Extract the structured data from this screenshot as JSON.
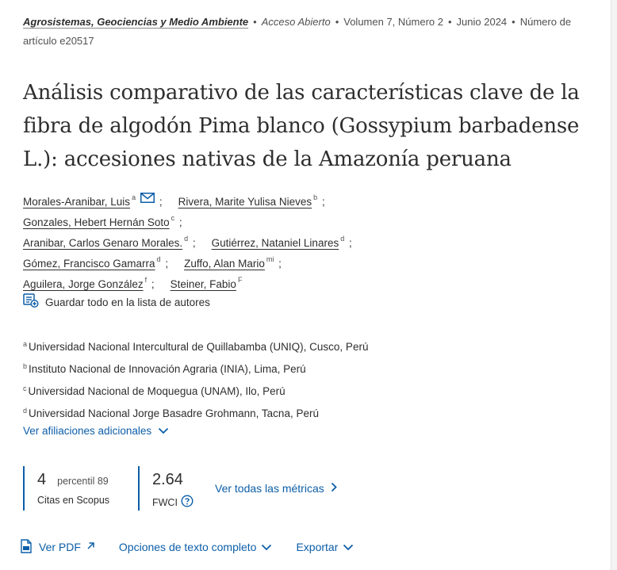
{
  "meta": {
    "journal": "Agrosistemas, Geociencias y Medio Ambiente",
    "access": "Acceso Abierto",
    "volume": "Volumen 7, Número 2",
    "date": "Junio 2024",
    "article_number": "Número de artículo e20517"
  },
  "title": "Análisis comparativo de las características clave de la fibra de algodón Pima blanco (Gossypium barbadense L.): accesiones nativas de la Amazonía peruana",
  "authors": [
    {
      "name": "Morales-Aranibar, Luis",
      "sup": "a"
    },
    {
      "name": "Rivera, Marite Yulisa Nieves",
      "sup": "b"
    },
    {
      "name": "Gonzales, Hebert Hernán Soto",
      "sup": "c"
    },
    {
      "name": "Aranibar, Carlos Genaro Morales.",
      "sup": "d"
    },
    {
      "name": "Gutiérrez, Nataniel Linares",
      "sup": "d"
    },
    {
      "name": "Gómez, Francisco Gamarra",
      "sup": "d"
    },
    {
      "name": "Zuffo, Alan Mario",
      "sup": "mi"
    },
    {
      "name": "Aguilera, Jorge González",
      "sup": "f"
    },
    {
      "name": "Steiner, Fabio",
      "sup": "F"
    }
  ],
  "save_authors_label": "Guardar todo en la lista de autores",
  "affiliations": [
    {
      "sup": "a",
      "text": "Universidad Nacional Intercultural de Quillabamba (UNIQ), Cusco, Perú"
    },
    {
      "sup": "b",
      "text": "Instituto Nacional de Innovación Agraria (INIA), Lima, Perú"
    },
    {
      "sup": "c",
      "text": "Universidad Nacional de Moquegua (UNAM), Ilo, Perú"
    },
    {
      "sup": "d",
      "text": "Universidad Nacional Jorge Basadre Grohmann, Tacna, Perú"
    }
  ],
  "more_affiliations_label": "Ver afiliaciones adicionales",
  "metrics": {
    "citations": "4",
    "percentile": "percentil 89",
    "citations_label": "Citas en Scopus",
    "fwci": "2.64",
    "fwci_label": "FWCI",
    "all_metrics_label": "Ver todas las métricas"
  },
  "actions": {
    "view_pdf": "Ver PDF",
    "full_text_options": "Opciones de texto completo",
    "export": "Exportar"
  },
  "icons": {
    "mail": "mail-icon",
    "save_list": "save-list-icon",
    "chevron": "chevron-down-icon",
    "help": "help-circle-icon",
    "arrow_right": "chevron-right-icon",
    "pdf": "pdf-file-icon",
    "external": "external-link-icon"
  },
  "colors": {
    "link": "#0c5ea8",
    "text": "#2e2e2e"
  }
}
